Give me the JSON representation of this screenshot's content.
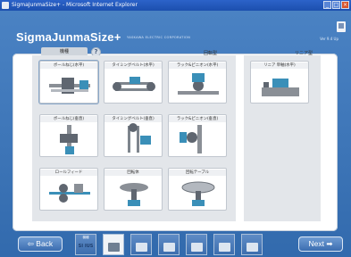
{
  "window": {
    "title": "SigmaJunmaSize+ - Microsoft Internet Explorer"
  },
  "app": {
    "title": "SigmaJunmaSize+",
    "company": "YASKAWA ELECTRIC CORPORATION",
    "version": "Ver 9.4 Up"
  },
  "header": {
    "select_label": "機種",
    "help_label": "?"
  },
  "sections": {
    "rotary_label": "回転型",
    "linear_label": "リニア型"
  },
  "rotary_items": [
    {
      "label": "ボールねじ(水平)"
    },
    {
      "label": "タイミングベルト(水平)"
    },
    {
      "label": "ラック&ピニオン(水平)"
    },
    {
      "label": "ボールねじ(垂直)"
    },
    {
      "label": "タイミングベルト(垂直)"
    },
    {
      "label": "ラック&ピニオン(垂直)"
    },
    {
      "label": "ロールフィード"
    },
    {
      "label": "回転体"
    },
    {
      "label": "回転テーブル"
    }
  ],
  "linear_items": [
    {
      "label": "リニア 単軸(水平)"
    }
  ],
  "nav": {
    "back_label": "⇦ Back",
    "next_label": "Next ➡"
  },
  "tabs": [
    {
      "caption": "機種",
      "icon_text": "SI IUS"
    },
    {
      "caption": "",
      "icon_text": ""
    },
    {
      "caption": "",
      "icon_text": ""
    },
    {
      "caption": "",
      "icon_text": ""
    },
    {
      "caption": "",
      "icon_text": ""
    },
    {
      "caption": "",
      "icon_text": ""
    },
    {
      "caption": "",
      "icon_text": ""
    }
  ],
  "colors": {
    "background": "#3e76b8",
    "panel": "#ffffff",
    "section": "#e3e6ea"
  }
}
